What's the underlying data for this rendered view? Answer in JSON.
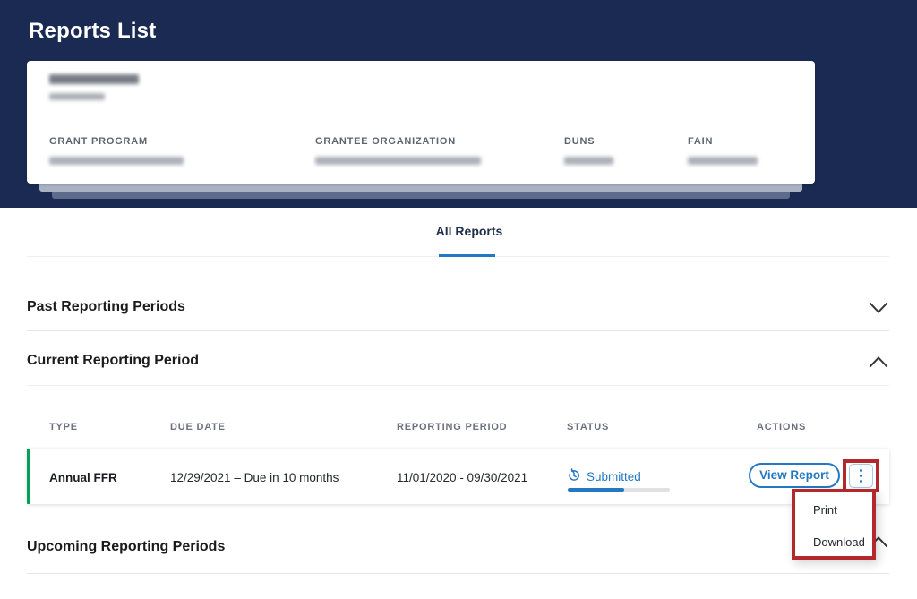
{
  "header": {
    "title": "Reports List"
  },
  "grant_card": {
    "field_labels": [
      "GRANT PROGRAM",
      "GRANTEE ORGANIZATION",
      "DUNS",
      "FAIN"
    ]
  },
  "tabs": {
    "active": "All Reports"
  },
  "sections": {
    "past": "Past Reporting Periods",
    "current": "Current Reporting Period",
    "upcoming": "Upcoming Reporting Periods"
  },
  "table": {
    "headers": [
      "TYPE",
      "DUE DATE",
      "REPORTING PERIOD",
      "STATUS",
      "ACTIONS"
    ],
    "row": {
      "type": "Annual FFR",
      "due_date": "12/29/2021 – Due in 10 months",
      "reporting_period": "11/01/2020 - 09/30/2021",
      "status": "Submitted",
      "action_label": "View Report"
    }
  },
  "action_menu": {
    "items": [
      "Print",
      "Download"
    ]
  },
  "colors": {
    "header_navy": "#1a2a52",
    "accent_blue": "#2378c3",
    "status_blue": "#2378c3",
    "success_green": "#00a05a",
    "annotation_red": "#b3282d"
  }
}
